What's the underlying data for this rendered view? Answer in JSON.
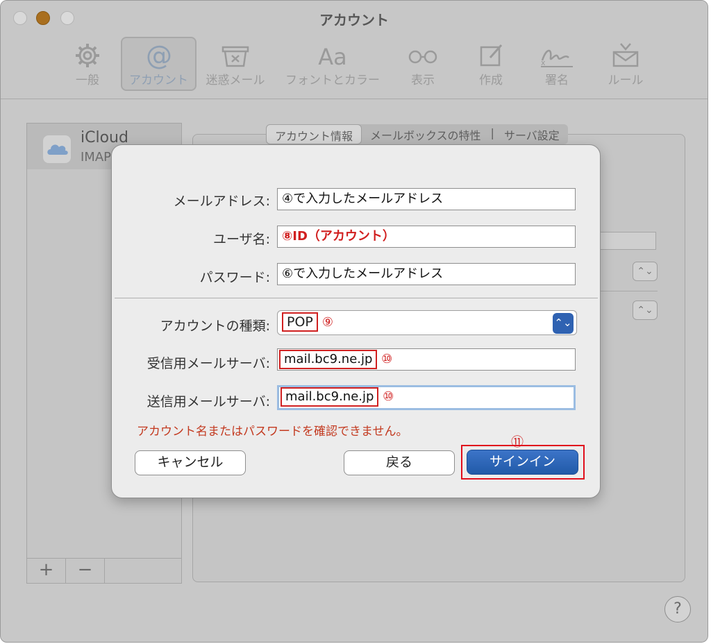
{
  "window": {
    "title": "アカウント"
  },
  "toolbar": {
    "items": [
      {
        "label": "一般",
        "icon": "gear-icon"
      },
      {
        "label": "アカウント",
        "icon": "at-icon",
        "selected": true
      },
      {
        "label": "迷惑メール",
        "icon": "junk-tray-icon"
      },
      {
        "label": "フォントとカラー",
        "icon": "fonts-aa-icon"
      },
      {
        "label": "表示",
        "icon": "glasses-icon"
      },
      {
        "label": "作成",
        "icon": "compose-icon"
      },
      {
        "label": "署名",
        "icon": "signature-icon"
      },
      {
        "label": "ルール",
        "icon": "rules-envelope-icon"
      }
    ]
  },
  "sidebar": {
    "account_name": "iCloud",
    "account_type": "IMAP",
    "add_label": "+",
    "remove_label": "−"
  },
  "detail": {
    "tabs": [
      "アカウント情報",
      "メールボックスの特性",
      "サーバ設定"
    ],
    "tab_separator": "|"
  },
  "dialog": {
    "email_label": "メールアドレス:",
    "email_value": "④で入力したメールアドレス",
    "username_label": "ユーザ名:",
    "username_value": "⑧ID（アカウント）",
    "password_label": "パスワード:",
    "password_value": "⑥で入力したメールアドレス",
    "account_type_label": "アカウントの種類:",
    "account_type_value": "POP",
    "account_type_step": "⑨",
    "incoming_label": "受信用メールサーバ:",
    "incoming_value": "mail.bc9.ne.jp",
    "incoming_step": "⑩",
    "outgoing_label": "送信用メールサーバ:",
    "outgoing_value": "mail.bc9.ne.jp",
    "outgoing_step": "⑩",
    "error_message": "アカウント名またはパスワードを確認できません。",
    "signin_step": "⑪",
    "cancel_label": "キャンセル",
    "back_label": "戻る",
    "signin_label": "サインイン"
  },
  "help_label": "?"
}
